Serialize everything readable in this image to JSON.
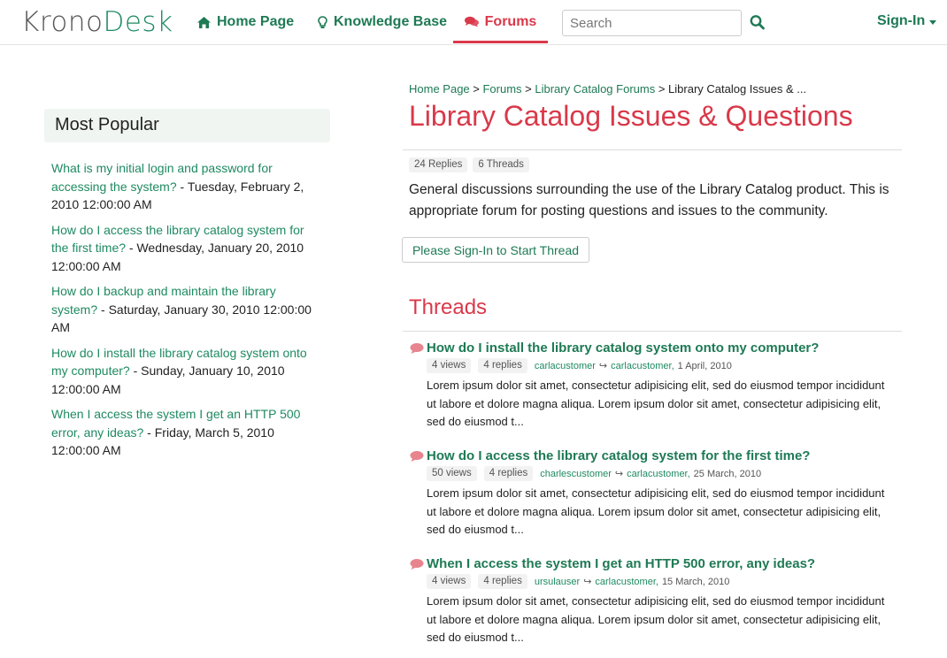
{
  "brand": {
    "part1": "Krono",
    "part2": "Desk"
  },
  "nav": {
    "home": "Home Page",
    "knowledge_base": "Knowledge Base",
    "forums": "Forums",
    "search_placeholder": "Search",
    "sign_in": "Sign-In"
  },
  "sidebar": {
    "heading": "Most Popular",
    "items": [
      {
        "link": "What is my initial login and password for accessing the system?",
        "date": " - Tuesday, February 2, 2010 12:00:00 AM"
      },
      {
        "link": "How do I access the library catalog system for the first time?",
        "date": " - Wednesday, January 20, 2010 12:00:00 AM"
      },
      {
        "link": "How do I backup and maintain the library system?",
        "date": " - Saturday, January 30, 2010 12:00:00 AM"
      },
      {
        "link": "How do I install the library catalog system onto my computer?",
        "date": " - Sunday, January 10, 2010 12:00:00 AM"
      },
      {
        "link": "When I access the system I get an HTTP 500 error, any ideas?",
        "date": " - Friday, March 5, 2010 12:00:00 AM"
      }
    ]
  },
  "breadcrumb": {
    "home": "Home Page",
    "forums": "Forums",
    "catalog_forums": "Library Catalog Forums",
    "sep": " > ",
    "current": "Library Catalog Issues & ..."
  },
  "forum": {
    "title": "Library Catalog Issues & Questions",
    "replies": "24 Replies",
    "threads": "6 Threads",
    "description": "General discussions surrounding the use of the Library Catalog product. This is appropriate forum for posting questions and issues to the community.",
    "start_button": "Please Sign-In to Start Thread",
    "threads_heading": "Threads"
  },
  "threads": [
    {
      "title": "How do I install the library catalog system onto my computer?",
      "views": "4 views",
      "replies": "4 replies",
      "author": "carlacustomer",
      "last_reply": "carlacustomer,",
      "date": "1 April, 2010",
      "excerpt": "Lorem ipsum dolor sit amet, consectetur adipisicing elit, sed do eiusmod tempor incididunt ut labore et dolore magna aliqua. Lorem ipsum dolor sit amet, consectetur adipisicing elit, sed do eiusmod t..."
    },
    {
      "title": "How do I access the library catalog system for the first time?",
      "views": "50 views",
      "replies": "4 replies",
      "author": "charlescustomer",
      "last_reply": "carlacustomer,",
      "date": "25 March, 2010",
      "excerpt": "Lorem ipsum dolor sit amet, consectetur adipisicing elit, sed do eiusmod tempor incididunt ut labore et dolore magna aliqua. Lorem ipsum dolor sit amet, consectetur adipisicing elit, sed do eiusmod t..."
    },
    {
      "title": "When I access the system I get an HTTP 500 error, any ideas?",
      "views": "4 views",
      "replies": "4 replies",
      "author": "ursulauser",
      "last_reply": "carlacustomer,",
      "date": "15 March, 2010",
      "excerpt": "Lorem ipsum dolor sit amet, consectetur adipisicing elit, sed do eiusmod tempor incididunt ut labore et dolore magna aliqua. Lorem ipsum dolor sit amet, consectetur adipisicing elit, sed do eiusmod t..."
    }
  ],
  "icons": {
    "home": "home-icon",
    "knowledge_base": "lightbulb-icon",
    "forums": "comments-icon",
    "search": "search-icon",
    "thread": "comment-bubble-icon",
    "reply": "reply-arrow-icon"
  },
  "colors": {
    "accent_green": "#1e7a54",
    "link_green": "#1e8a62",
    "accent_red": "#d9394a",
    "bubble_pink": "#e8848d"
  }
}
